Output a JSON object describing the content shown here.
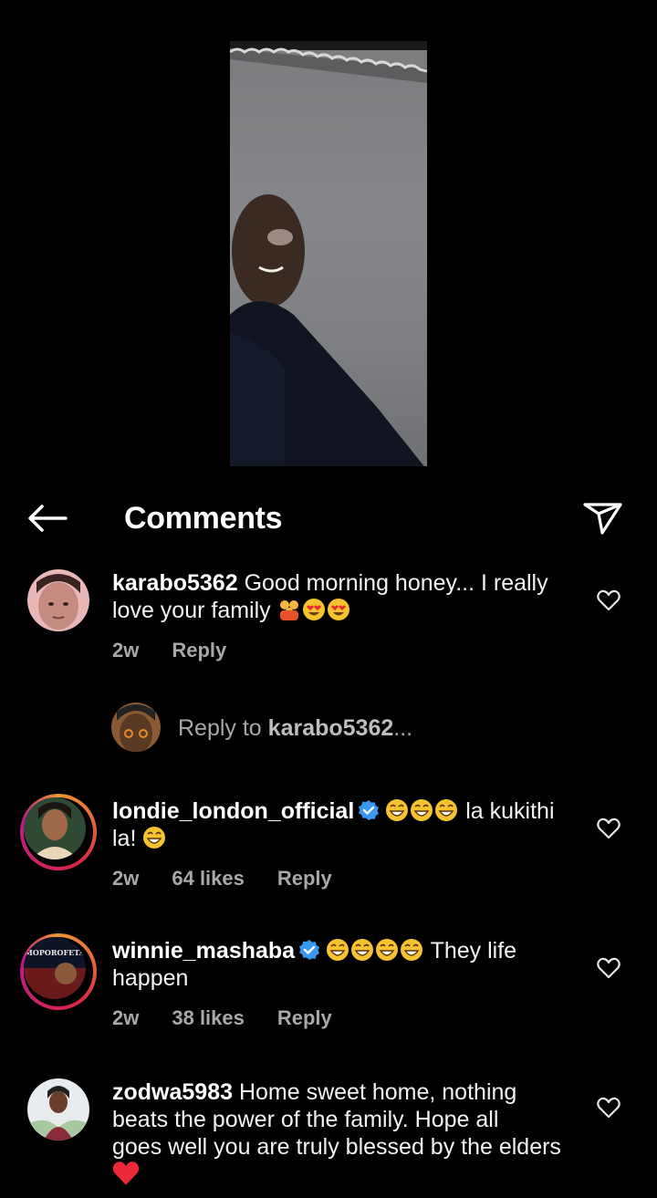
{
  "header": {
    "title": "Comments",
    "back_icon": "arrow-left-icon",
    "share_icon": "paper-plane-icon"
  },
  "colors": {
    "background": "#000000",
    "meta_text": "#a8a8a8",
    "verified": "#3897f0",
    "heart_red": "#ed2939",
    "story_ring": [
      "#f09433",
      "#dc2743",
      "#bc1888"
    ]
  },
  "comments": [
    {
      "username": "karabo5362",
      "text_line1": "Good morning honey... I really",
      "text_line2": "love your family",
      "emojis": [
        "family-emoji",
        "heart-eyes-emoji",
        "heart-eyes-emoji"
      ],
      "time": "2w",
      "likes": "",
      "reply_label": "Reply",
      "verified": false
    },
    {
      "username": "londie_london_official",
      "text_line1": "la kukithi",
      "text_line2": "la!",
      "emojis": [
        "grinning-emoji",
        "grinning-emoji",
        "grinning-emoji",
        "grinning-emoji"
      ],
      "time": "2w",
      "likes": "64 likes",
      "reply_label": "Reply",
      "verified": true
    },
    {
      "username": "winnie_mashaba",
      "text_line1": "They life",
      "text_line2": "happen",
      "emojis": [
        "grinning-emoji",
        "grinning-emoji",
        "grinning-emoji",
        "grinning-emoji"
      ],
      "time": "2w",
      "likes": "38 likes",
      "reply_label": "Reply",
      "verified": true,
      "avatar_text": "MOPOROFETA"
    },
    {
      "username": "zodwa5983",
      "text_line1": "Home sweet home, nothing",
      "text_line2": "beats the power of the family. Hope all",
      "text_line3": "goes well you are truly blessed by the elders",
      "emojis": [
        "red-heart-emoji"
      ],
      "verified": false
    }
  ],
  "reply_composer": {
    "prefix": "Reply to",
    "target": "karabo5362",
    "suffix": "..."
  }
}
